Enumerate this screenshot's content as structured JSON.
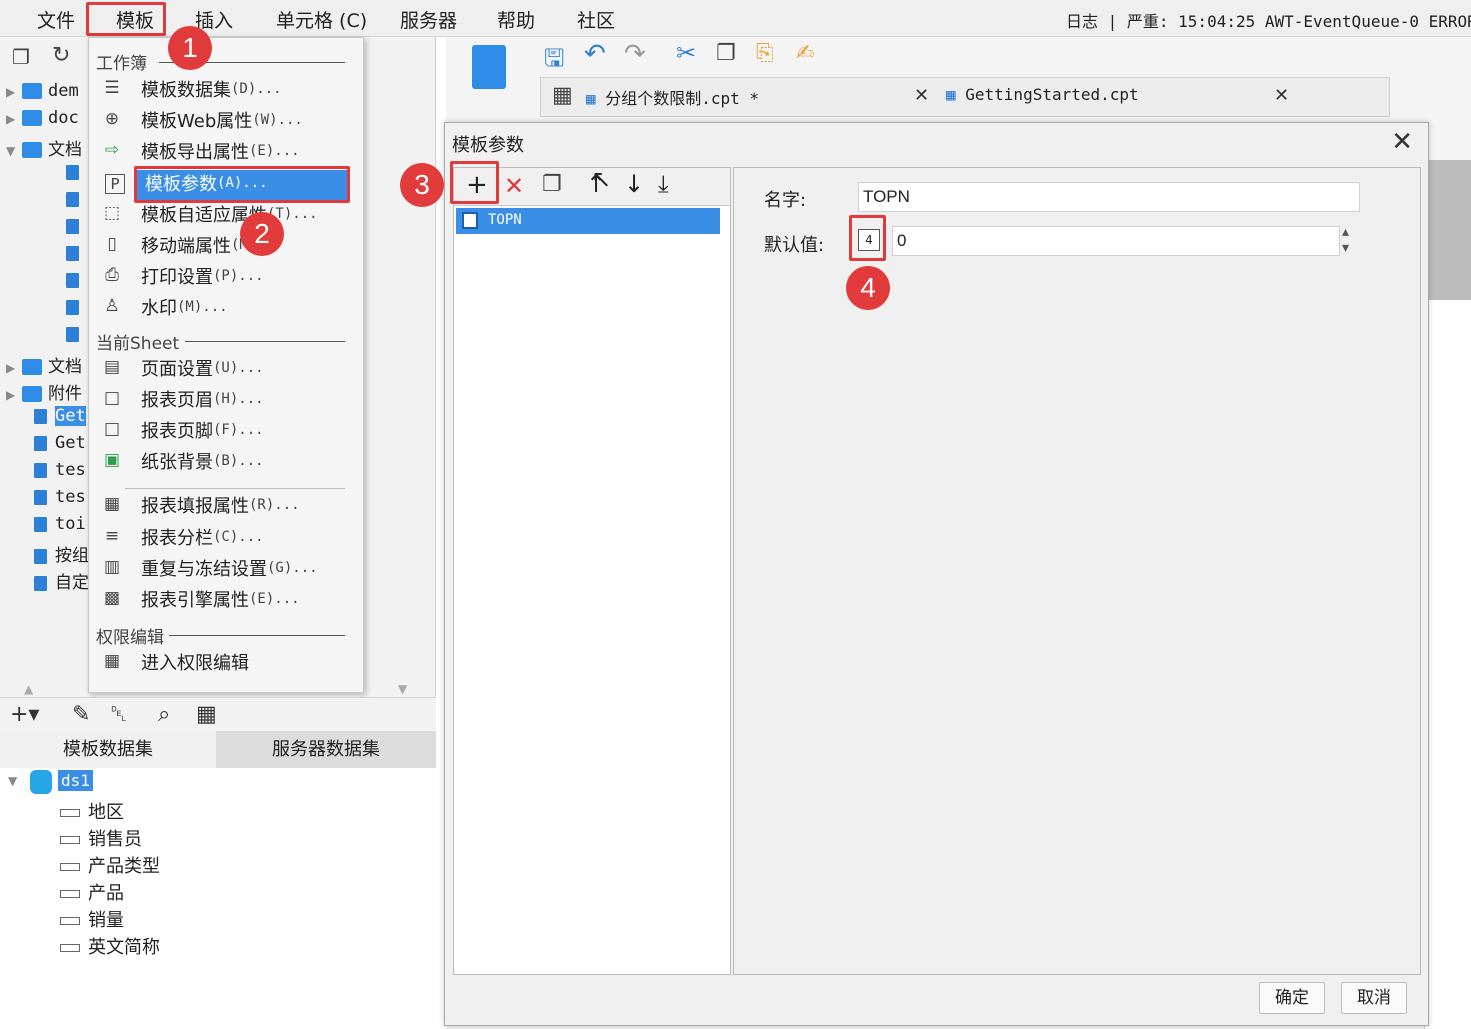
{
  "menubar": {
    "items": [
      "文件",
      "模板",
      "插入",
      "单元格 (C)",
      "服务器",
      "帮助",
      "社区"
    ],
    "status": "日志 | 严重: 15:04:25 AWT-EventQueue-0 ERROR"
  },
  "annotations": [
    "1",
    "2",
    "3",
    "4"
  ],
  "left_tree": {
    "rows": [
      "dem",
      "doc",
      "文档",
      "文档",
      "附件",
      "Get",
      "Get",
      "tes",
      "tes",
      "toi",
      "按组",
      "自定"
    ]
  },
  "dropdown": {
    "section_workbook": "工作簿",
    "section_sheet": "当前Sheet",
    "section_permission": "权限编辑",
    "items": [
      {
        "label": "模板数据集",
        "accel": "(D)..."
      },
      {
        "label": "模板Web属性",
        "accel": "(W)..."
      },
      {
        "label": "模板导出属性",
        "accel": "(E)..."
      },
      {
        "label": "模板参数",
        "accel": "(A)..."
      },
      {
        "label": "模板自适应属性",
        "accel": "(T)..."
      },
      {
        "label": "移动端属性",
        "accel": "(M)..."
      },
      {
        "label": "打印设置",
        "accel": "(P)..."
      },
      {
        "label": "水印",
        "accel": "(M)..."
      },
      {
        "label": "页面设置",
        "accel": "(U)..."
      },
      {
        "label": "报表页眉",
        "accel": "(H)..."
      },
      {
        "label": "报表页脚",
        "accel": "(F)..."
      },
      {
        "label": "纸张背景",
        "accel": "(B)..."
      },
      {
        "label": "报表填报属性",
        "accel": "(R)..."
      },
      {
        "label": "报表分栏",
        "accel": "(C)..."
      },
      {
        "label": "重复与冻结设置",
        "accel": "(G)..."
      },
      {
        "label": "报表引擎属性",
        "accel": "(E)..."
      },
      {
        "label": "进入权限编辑",
        "accel": ""
      }
    ]
  },
  "dataset_tabs": [
    "模板数据集",
    "服务器数据集"
  ],
  "dataset_tree": {
    "root": "ds1",
    "fields": [
      "地区",
      "销售员",
      "产品类型",
      "产品",
      "销量",
      "英文简称"
    ]
  },
  "file_tabs": [
    "分组个数限制.cpt *",
    "GettingStarted.cpt"
  ],
  "dialog": {
    "title": "模板参数",
    "list": [
      "TOPN"
    ],
    "name_label": "名字:",
    "name_value": "TOPN",
    "default_label": "默认值:",
    "default_value": "0",
    "ok": "确定",
    "cancel": "取消"
  }
}
